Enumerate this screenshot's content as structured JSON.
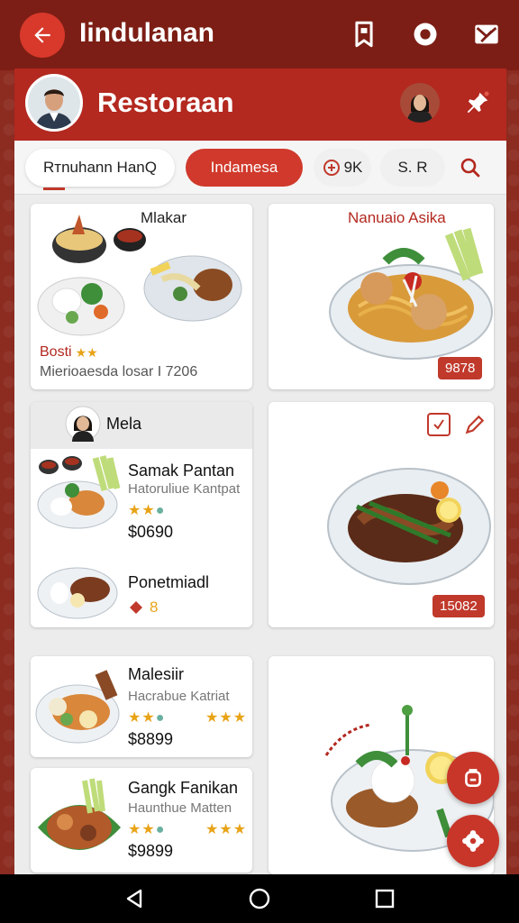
{
  "appbar": {
    "title": "Iindulanan"
  },
  "panel": {
    "title": "Restoraan"
  },
  "tabs": [
    {
      "label": "Rтnuhann HanQ"
    },
    {
      "label": "Indamesa"
    },
    {
      "label": "9K"
    },
    {
      "label": "S. R"
    }
  ],
  "cards": {
    "c1": {
      "title": "Mlakar",
      "rating_text": "Bosti",
      "desc": "Mierioaesda losar I 7206"
    },
    "c2": {
      "title": "Nanuaio Asika",
      "price": "9878"
    },
    "c3": {
      "section": "Mela",
      "item1": {
        "name": "Samak Pantan",
        "sub": "Hatoruliue Kantpat",
        "price": "$0690"
      },
      "item2": {
        "name": "Ponetmiadl",
        "badge": "8"
      }
    },
    "c4": {
      "price": "15082"
    },
    "c5": {
      "name": "Malesiir",
      "sub": "Hacrabue Katriat",
      "price": "$8899"
    },
    "c6": {
      "name": "Gangk Fanikan",
      "sub": "Haunthue Matten",
      "price": "$9899"
    }
  },
  "colors": {
    "primary": "#b3281f",
    "dark": "#7c1e15",
    "accent": "#d0392b",
    "star": "#e8a317"
  },
  "icons": [
    "back-arrow-icon",
    "bookmark-icon",
    "record-icon",
    "mail-icon",
    "pin-icon",
    "search-icon",
    "settings-icon",
    "basket-icon"
  ]
}
